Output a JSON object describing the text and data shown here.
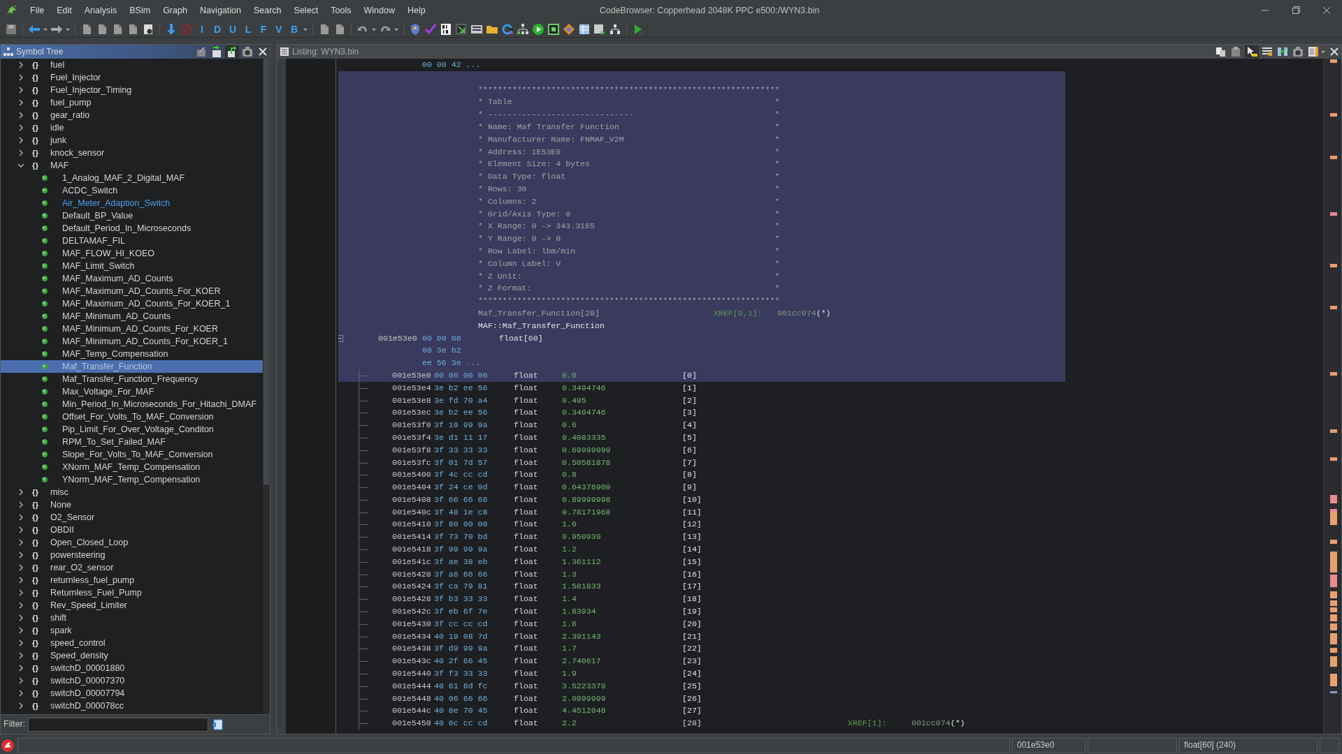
{
  "window": {
    "title": "CodeBrowser: Copperhead 2048K PPC e500:/WYN3.bin"
  },
  "menu": [
    "File",
    "Edit",
    "Analysis",
    "BSim",
    "Graph",
    "Navigation",
    "Search",
    "Select",
    "Tools",
    "Window",
    "Help"
  ],
  "toolbar": {
    "letter_buttons": [
      "I",
      "D",
      "U",
      "L",
      "F",
      "V",
      "B"
    ]
  },
  "symbol_tree": {
    "title": "Symbol Tree",
    "items": [
      {
        "label": "fuel",
        "icon": "{}",
        "expanded": false
      },
      {
        "label": "Fuel_Injector",
        "icon": "{}",
        "expanded": false
      },
      {
        "label": "Fuel_Injector_Timing",
        "icon": "{}",
        "expanded": false
      },
      {
        "label": "fuel_pump",
        "icon": "{}",
        "expanded": false
      },
      {
        "label": "gear_ratio",
        "icon": "{}",
        "expanded": false
      },
      {
        "label": "idle",
        "icon": "{}",
        "expanded": false
      },
      {
        "label": "junk",
        "icon": "{}",
        "expanded": false
      },
      {
        "label": "knock_sensor",
        "icon": "{}",
        "expanded": false
      },
      {
        "label": "MAF",
        "icon": "{}",
        "expanded": true,
        "children": [
          {
            "label": "1_Analog_MAF_2_Digital_MAF",
            "selected": false,
            "linked": false
          },
          {
            "label": "ACDC_Switch",
            "selected": false,
            "linked": false
          },
          {
            "label": "Air_Meter_Adaption_Switch",
            "selected": false,
            "linked": true
          },
          {
            "label": "Default_BP_Value",
            "selected": false,
            "linked": false
          },
          {
            "label": "Default_Period_In_Microseconds",
            "selected": false,
            "linked": false
          },
          {
            "label": "DELTAMAF_FIL",
            "selected": false,
            "linked": false
          },
          {
            "label": "MAF_FLOW_HI_KOEO",
            "selected": false,
            "linked": false
          },
          {
            "label": "MAF_Limit_Switch",
            "selected": false,
            "linked": false
          },
          {
            "label": "MAF_Maximum_AD_Counts",
            "selected": false,
            "linked": false
          },
          {
            "label": "MAF_Maximum_AD_Counts_For_KOER",
            "selected": false,
            "linked": false
          },
          {
            "label": "MAF_Maximum_AD_Counts_For_KOER_1",
            "selected": false,
            "linked": false
          },
          {
            "label": "MAF_Minimum_AD_Counts",
            "selected": false,
            "linked": false
          },
          {
            "label": "MAF_Minimum_AD_Counts_For_KOER",
            "selected": false,
            "linked": false
          },
          {
            "label": "MAF_Minimum_AD_Counts_For_KOER_1",
            "selected": false,
            "linked": false
          },
          {
            "label": "MAF_Temp_Compensation",
            "selected": false,
            "linked": false
          },
          {
            "label": "Maf_Transfer_Function",
            "selected": true,
            "linked": false
          },
          {
            "label": "Maf_Transfer_Function_Frequency",
            "selected": false,
            "linked": false
          },
          {
            "label": "Max_Voltage_For_MAF",
            "selected": false,
            "linked": false
          },
          {
            "label": "Min_Period_In_Microseconds_For_Hitachi_DMAF",
            "selected": false,
            "linked": false
          },
          {
            "label": "Offset_For_Volts_To_MAF_Conversion",
            "selected": false,
            "linked": false
          },
          {
            "label": "Pip_Limit_For_Over_Voltage_Conditon",
            "selected": false,
            "linked": false
          },
          {
            "label": "RPM_To_Set_Failed_MAF",
            "selected": false,
            "linked": false
          },
          {
            "label": "Slope_For_Volts_To_MAF_Conversion",
            "selected": false,
            "linked": false
          },
          {
            "label": "XNorm_MAF_Temp_Compensation",
            "selected": false,
            "linked": false
          },
          {
            "label": "YNorm_MAF_Temp_Compensation",
            "selected": false,
            "linked": false
          }
        ]
      },
      {
        "label": "misc",
        "icon": "{}",
        "expanded": false
      },
      {
        "label": "None",
        "icon": "{}",
        "expanded": false
      },
      {
        "label": "O2_Sensor",
        "icon": "{}",
        "expanded": false
      },
      {
        "label": "OBDII",
        "icon": "{}",
        "expanded": false
      },
      {
        "label": "Open_Closed_Loop",
        "icon": "{}",
        "expanded": false
      },
      {
        "label": "powersteering",
        "icon": "{}",
        "expanded": false
      },
      {
        "label": "rear_O2_sensor",
        "icon": "{}",
        "expanded": false
      },
      {
        "label": "returnless_fuel_pump",
        "icon": "{}",
        "expanded": false
      },
      {
        "label": "Returnless_Fuel_Pump",
        "icon": "{}",
        "expanded": false
      },
      {
        "label": "Rev_Speed_Limiter",
        "icon": "{}",
        "expanded": false
      },
      {
        "label": "shift",
        "icon": "{}",
        "expanded": false
      },
      {
        "label": "spark",
        "icon": "{}",
        "expanded": false
      },
      {
        "label": "speed_control",
        "icon": "{}",
        "expanded": false
      },
      {
        "label": "Speed_density",
        "icon": "{}",
        "expanded": false
      },
      {
        "label": "switchD_00001880",
        "icon": "{}",
        "expanded": false
      },
      {
        "label": "switchD_00007370",
        "icon": "{}",
        "expanded": false
      },
      {
        "label": "switchD_00007794",
        "icon": "{}",
        "expanded": false
      },
      {
        "label": "switchD_000078cc",
        "icon": "{}",
        "expanded": false
      }
    ],
    "filter": {
      "label": "Filter:"
    }
  },
  "listing": {
    "title": "Listing:  WYN3.bin",
    "lines": [
      {
        "kind": "bytes",
        "bytes": "00 00 42 ...",
        "selected": false
      },
      {
        "kind": "blank",
        "selected": true
      },
      {
        "kind": "comment",
        "text": "**************************************************************",
        "selected": true
      },
      {
        "kind": "comment",
        "text": "* Table",
        "end": "*",
        "selected": true
      },
      {
        "kind": "comment",
        "text": "* ------------------------------",
        "end": "*",
        "selected": true
      },
      {
        "kind": "comment",
        "text": "* Name: Maf Transfer Function",
        "end": "*",
        "selected": true
      },
      {
        "kind": "comment",
        "text": "* Manufacturer Name: FNMAF_V2M",
        "end": "*",
        "selected": true
      },
      {
        "kind": "comment",
        "text": "* Address: 1E53E0",
        "end": "*",
        "selected": true
      },
      {
        "kind": "comment",
        "text": "* Element Size: 4 bytes",
        "end": "*",
        "selected": true
      },
      {
        "kind": "comment",
        "text": "* Data Type: float",
        "end": "*",
        "selected": true
      },
      {
        "kind": "comment",
        "text": "* Rows: 30",
        "end": "*",
        "selected": true
      },
      {
        "kind": "comment",
        "text": "* Columns: 2",
        "end": "*",
        "selected": true
      },
      {
        "kind": "comment",
        "text": "* Grid/Axis Type: 0",
        "end": "*",
        "selected": true
      },
      {
        "kind": "comment",
        "text": "* X Range: 0 -> 343.3165",
        "end": "*",
        "selected": true
      },
      {
        "kind": "comment",
        "text": "* Y Range: 0 -> 0",
        "end": "*",
        "selected": true
      },
      {
        "kind": "comment",
        "text": "* Row Label: lbm/min",
        "end": "*",
        "selected": true
      },
      {
        "kind": "comment",
        "text": "* Column Label: V",
        "end": "*",
        "selected": true
      },
      {
        "kind": "comment",
        "text": "* Z Unit:",
        "end": "*",
        "selected": true
      },
      {
        "kind": "comment",
        "text": "* Z Format:",
        "end": "*",
        "selected": true
      },
      {
        "kind": "comment",
        "text": "**************************************************************",
        "selected": true
      },
      {
        "kind": "label",
        "text": "Maf_Transfer_Function[28]",
        "xref": "XREF[0,1]:",
        "xref_addr": "001cc074",
        "xref_mark": "(*)",
        "selected": true
      },
      {
        "kind": "namespace",
        "text": "MAF::Maf_Transfer_Function",
        "selected": true
      },
      {
        "kind": "data",
        "address": "001e53e0",
        "bytes": "00 00 00",
        "type": "float[60]",
        "expanded": true,
        "selected": true
      },
      {
        "kind": "bytes",
        "bytes": "00 3e b2",
        "selected": true
      },
      {
        "kind": "bytes",
        "bytes": "ee 56 3e ...",
        "selected": true
      },
      {
        "kind": "element",
        "address": "001e53e0",
        "bytes": "00 00 00 00",
        "type": "float",
        "value": "0.0",
        "index": "[0]",
        "selected": true
      },
      {
        "kind": "element",
        "address": "001e53e4",
        "bytes": "3e b2 ee 56",
        "type": "float",
        "value": "0.3494746",
        "index": "[1]",
        "selected": false
      },
      {
        "kind": "element",
        "address": "001e53e8",
        "bytes": "3e fd 70 a4",
        "type": "float",
        "value": "0.495",
        "index": "[2]",
        "selected": false
      },
      {
        "kind": "element",
        "address": "001e53ec",
        "bytes": "3e b2 ee 56",
        "type": "float",
        "value": "0.3494746",
        "index": "[3]",
        "selected": false
      },
      {
        "kind": "element",
        "address": "001e53f0",
        "bytes": "3f 19 99 9a",
        "type": "float",
        "value": "0.6",
        "index": "[4]",
        "selected": false
      },
      {
        "kind": "element",
        "address": "001e53f4",
        "bytes": "3e d1 11 17",
        "type": "float",
        "value": "0.4083335",
        "index": "[5]",
        "selected": false
      },
      {
        "kind": "element",
        "address": "001e53f8",
        "bytes": "3f 33 33 33",
        "type": "float",
        "value": "0.69999999",
        "index": "[6]",
        "selected": false
      },
      {
        "kind": "element",
        "address": "001e53fc",
        "bytes": "3f 01 7d 57",
        "type": "float",
        "value": "0.50581878",
        "index": "[7]",
        "selected": false
      },
      {
        "kind": "element",
        "address": "001e5400",
        "bytes": "3f 4c cc cd",
        "type": "float",
        "value": "0.8",
        "index": "[8]",
        "selected": false
      },
      {
        "kind": "element",
        "address": "001e5404",
        "bytes": "3f 24 ce 0d",
        "type": "float",
        "value": "0.64376909",
        "index": "[9]",
        "selected": false
      },
      {
        "kind": "element",
        "address": "001e5408",
        "bytes": "3f 66 66 66",
        "type": "float",
        "value": "0.89999998",
        "index": "[10]",
        "selected": false
      },
      {
        "kind": "element",
        "address": "001e540c",
        "bytes": "3f 48 1e c8",
        "type": "float",
        "value": "0.78171968",
        "index": "[11]",
        "selected": false
      },
      {
        "kind": "element",
        "address": "001e5410",
        "bytes": "3f 80 00 00",
        "type": "float",
        "value": "1.0",
        "index": "[12]",
        "selected": false
      },
      {
        "kind": "element",
        "address": "001e5414",
        "bytes": "3f 73 70 bd",
        "type": "float",
        "value": "0.950939",
        "index": "[13]",
        "selected": false
      },
      {
        "kind": "element",
        "address": "001e5418",
        "bytes": "3f 99 99 9a",
        "type": "float",
        "value": "1.2",
        "index": "[14]",
        "selected": false
      },
      {
        "kind": "element",
        "address": "001e541c",
        "bytes": "3f ae 38 eb",
        "type": "float",
        "value": "1.361112",
        "index": "[15]",
        "selected": false
      },
      {
        "kind": "element",
        "address": "001e5420",
        "bytes": "3f a6 66 66",
        "type": "float",
        "value": "1.3",
        "index": "[16]",
        "selected": false
      },
      {
        "kind": "element",
        "address": "001e5424",
        "bytes": "3f ca 79 81",
        "type": "float",
        "value": "1.581833",
        "index": "[17]",
        "selected": false
      },
      {
        "kind": "element",
        "address": "001e5428",
        "bytes": "3f b3 33 33",
        "type": "float",
        "value": "1.4",
        "index": "[18]",
        "selected": false
      },
      {
        "kind": "element",
        "address": "001e542c",
        "bytes": "3f eb 6f 7e",
        "type": "float",
        "value": "1.83934",
        "index": "[19]",
        "selected": false
      },
      {
        "kind": "element",
        "address": "001e5430",
        "bytes": "3f cc cc cd",
        "type": "float",
        "value": "1.6",
        "index": "[20]",
        "selected": false
      },
      {
        "kind": "element",
        "address": "001e5434",
        "bytes": "40 19 08 7d",
        "type": "float",
        "value": "2.391143",
        "index": "[21]",
        "selected": false
      },
      {
        "kind": "element",
        "address": "001e5438",
        "bytes": "3f d9 99 9a",
        "type": "float",
        "value": "1.7",
        "index": "[22]",
        "selected": false
      },
      {
        "kind": "element",
        "address": "001e543c",
        "bytes": "40 2f 66 45",
        "type": "float",
        "value": "2.740617",
        "index": "[23]",
        "selected": false
      },
      {
        "kind": "element",
        "address": "001e5440",
        "bytes": "3f f3 33 33",
        "type": "float",
        "value": "1.9",
        "index": "[24]",
        "selected": false
      },
      {
        "kind": "element",
        "address": "001e5444",
        "bytes": "40 61 6d fc",
        "type": "float",
        "value": "3.5223379",
        "index": "[25]",
        "selected": false
      },
      {
        "kind": "element",
        "address": "001e5448",
        "bytes": "40 06 66 66",
        "type": "float",
        "value": "2.0999999",
        "index": "[26]",
        "selected": false
      },
      {
        "kind": "element",
        "address": "001e544c",
        "bytes": "40 8e 70 45",
        "type": "float",
        "value": "4.4512048",
        "index": "[27]",
        "selected": false
      },
      {
        "kind": "element",
        "address": "001e5450",
        "bytes": "40 0c cc cd",
        "type": "float",
        "value": "2.2",
        "index": "[28]",
        "xref": "XREF[1]:",
        "xref_addr": "001cc074",
        "xref_mark": "(*)",
        "selected": false
      }
    ]
  },
  "status_bar": {
    "address": "001e53e0",
    "data_type": "float[60]  (240)"
  }
}
